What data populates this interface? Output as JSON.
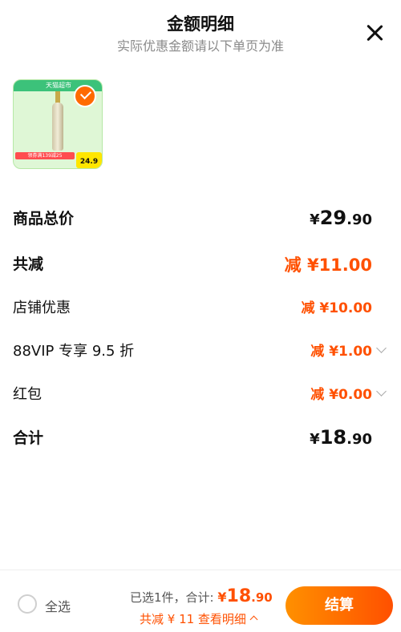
{
  "header": {
    "title": "金额明细",
    "subtitle": "实际优惠金额请以下单页为准"
  },
  "product": {
    "store_tag": "天猫超市",
    "badge_text": "领券满139减25",
    "price_text": "24.9",
    "selected": true
  },
  "breakdown": {
    "total_price_label": "商品总价",
    "total_price_symbol": "¥",
    "total_price_int": "29",
    "total_price_dec": ".90",
    "discount_label": "共减",
    "discount_value": "减 ¥11.00",
    "store_discount_label": "店铺优惠",
    "store_discount_value": "减 ¥10.00",
    "vip_label": "88VIP 专享 9.5 折",
    "vip_value": "减 ¥1.00",
    "redpacket_label": "红包",
    "redpacket_value": "减 ¥0.00",
    "sum_label": "合计",
    "sum_symbol": "¥",
    "sum_int": "18",
    "sum_dec": ".90"
  },
  "footer": {
    "select_all": "全选",
    "selected_count": "已选1件，合计:",
    "total_symbol": "¥",
    "total_value": "18",
    "total_dec": ".90",
    "detail_text": "共减 ¥ 11 查看明细",
    "checkout_label": "结算"
  },
  "colors": {
    "accent": "#ff5000",
    "checkout_gradient_start": "#ff9000"
  }
}
